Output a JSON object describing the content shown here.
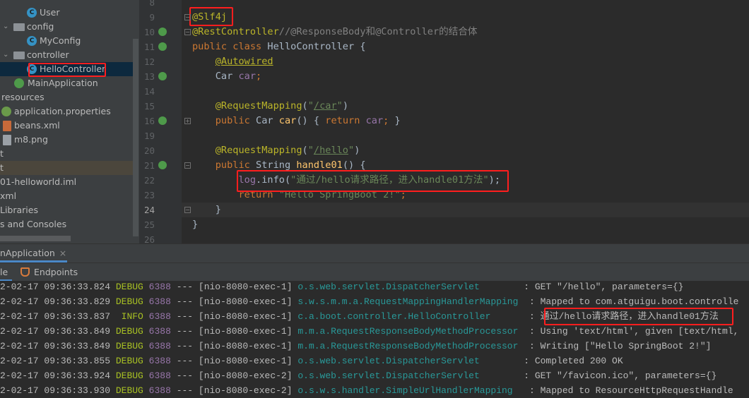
{
  "project_tree": [
    {
      "label": "User",
      "type": "class",
      "indent": 2
    },
    {
      "label": "config",
      "type": "folder",
      "indent": 1,
      "expanded": true
    },
    {
      "label": "MyConfig",
      "type": "class",
      "indent": 2
    },
    {
      "label": "controller",
      "type": "folder",
      "indent": 1,
      "expanded": true
    },
    {
      "label": "HelloController",
      "type": "class",
      "indent": 2,
      "selected": true
    },
    {
      "label": "MainApplication",
      "type": "spring-class",
      "indent": 1
    },
    {
      "label": "resources",
      "type": "text",
      "indent": 0
    },
    {
      "label": "application.properties",
      "type": "spring-file",
      "indent": 0
    },
    {
      "label": "beans.xml",
      "type": "xml-file",
      "indent": 0
    },
    {
      "label": "m8.png",
      "type": "image-file",
      "indent": 0
    },
    {
      "label": "t",
      "type": "text",
      "indent": -1
    },
    {
      "label": "t",
      "type": "text",
      "indent": -1,
      "highlighted": true
    },
    {
      "label": "01-helloworld.iml",
      "type": "text",
      "indent": -1
    },
    {
      "label": "xml",
      "type": "text",
      "indent": -1
    },
    {
      "label": "Libraries",
      "type": "text",
      "indent": -1
    },
    {
      "label": "s and Consoles",
      "type": "text",
      "indent": -1
    }
  ],
  "editor": {
    "line_numbers": [
      "8",
      "9",
      "10",
      "11",
      "12",
      "13",
      "14",
      "15",
      "16",
      "19",
      "20",
      "21",
      "22",
      "23",
      "24",
      "25",
      "26"
    ],
    "current_line": "24",
    "lines": [
      [],
      [
        [
          "@Slf4j",
          "an"
        ]
      ],
      [
        [
          "@RestController",
          "an"
        ],
        [
          "//@ResponseBody和@Controller的结合体",
          "cm"
        ]
      ],
      [
        [
          "public class ",
          "kw"
        ],
        [
          "HelloController {",
          "pl"
        ]
      ],
      [
        [
          "    ",
          "pl"
        ],
        [
          "@Autowired",
          "an u"
        ]
      ],
      [
        [
          "    Car ",
          "pl"
        ],
        [
          "car",
          "fd"
        ],
        [
          ";",
          "kw"
        ]
      ],
      [],
      [
        [
          "    ",
          "pl"
        ],
        [
          "@RequestMapping",
          "an"
        ],
        [
          "(",
          "pl"
        ],
        [
          "\"",
          "st"
        ],
        [
          "/car",
          "st u"
        ],
        [
          "\"",
          "st"
        ],
        [
          ")",
          "pl"
        ]
      ],
      [
        [
          "    ",
          "pl"
        ],
        [
          "public ",
          "kw"
        ],
        [
          "Car ",
          "pl"
        ],
        [
          "car",
          "mt"
        ],
        [
          "() { ",
          "pl"
        ],
        [
          "return ",
          "kw"
        ],
        [
          "car",
          "fd"
        ],
        [
          ";",
          "kw"
        ],
        [
          " }",
          "pl"
        ]
      ],
      [],
      [
        [
          "    ",
          "pl"
        ],
        [
          "@RequestMapping",
          "an"
        ],
        [
          "(",
          "pl"
        ],
        [
          "\"",
          "st"
        ],
        [
          "/hello",
          "st u"
        ],
        [
          "\"",
          "st"
        ],
        [
          ")",
          "pl"
        ]
      ],
      [
        [
          "    ",
          "pl"
        ],
        [
          "public ",
          "kw"
        ],
        [
          "String ",
          "pl"
        ],
        [
          "handle01",
          "mt"
        ],
        [
          "() {",
          "pl"
        ]
      ],
      [
        [
          "        ",
          "pl"
        ],
        [
          "log",
          "fd"
        ],
        [
          ".info(",
          "pl"
        ],
        [
          "\"通过/hello请求路径，进入handle01方法\"",
          "st"
        ],
        [
          ");",
          "pl"
        ]
      ],
      [
        [
          "        ",
          "pl"
        ],
        [
          "return ",
          "kw"
        ],
        [
          "\"Hello SpringBoot 2!\"",
          "st"
        ],
        [
          ";",
          "kw"
        ]
      ],
      [
        [
          "    }",
          "pl"
        ]
      ],
      [
        [
          "}",
          "pl"
        ]
      ],
      []
    ]
  },
  "run_panel": {
    "tab_label": "nApplication",
    "toolbar": {
      "console_label": "le",
      "endpoints_label": "Endpoints"
    },
    "log": [
      {
        "ts": "2-02-17 09:36:33.824",
        "level": "DEBUG",
        "pid": "6388",
        "thread": "[nio-8080-exec-1]",
        "logger": "o.s.web.servlet.DispatcherServlet       ",
        "msg": "GET \"/hello\", parameters={}"
      },
      {
        "ts": "2-02-17 09:36:33.829",
        "level": "DEBUG",
        "pid": "6388",
        "thread": "[nio-8080-exec-1]",
        "logger": "s.w.s.m.m.a.RequestMappingHandlerMapping ",
        "msg": "Mapped to com.atguigu.boot.controlle"
      },
      {
        "ts": "2-02-17 09:36:33.837",
        "level": " INFO",
        "pid": "6388",
        "thread": "[nio-8080-exec-1]",
        "logger": "c.a.boot.controller.HelloController      ",
        "msg": "通过/hello请求路径，进入handle01方法"
      },
      {
        "ts": "2-02-17 09:36:33.849",
        "level": "DEBUG",
        "pid": "6388",
        "thread": "[nio-8080-exec-1]",
        "logger": "m.m.a.RequestResponseBodyMethodProcessor ",
        "msg": "Using 'text/html', given [text/html,"
      },
      {
        "ts": "2-02-17 09:36:33.849",
        "level": "DEBUG",
        "pid": "6388",
        "thread": "[nio-8080-exec-1]",
        "logger": "m.m.a.RequestResponseBodyMethodProcessor ",
        "msg": "Writing [\"Hello SpringBoot 2!\"]"
      },
      {
        "ts": "2-02-17 09:36:33.855",
        "level": "DEBUG",
        "pid": "6388",
        "thread": "[nio-8080-exec-1]",
        "logger": "o.s.web.servlet.DispatcherServlet       ",
        "msg": "Completed 200 OK"
      },
      {
        "ts": "2-02-17 09:36:33.924",
        "level": "DEBUG",
        "pid": "6388",
        "thread": "[nio-8080-exec-2]",
        "logger": "o.s.web.servlet.DispatcherServlet       ",
        "msg": "GET \"/favicon.ico\", parameters={}"
      },
      {
        "ts": "2-02-17 09:36:33.930",
        "level": "DEBUG",
        "pid": "6388",
        "thread": "[nio-8080-exec-2]",
        "logger": "o.s.w.s.handler.SimpleUrlHandlerMapping  ",
        "msg": "Mapped to ResourceHttpRequestHandle"
      }
    ]
  },
  "colors": {
    "highlight_box": "#ff1e1e",
    "keyword": "#cc7832",
    "annotation": "#bbb529",
    "string": "#6a8759",
    "field": "#9876aa",
    "method": "#ffc66d",
    "selection": "#0d293e"
  }
}
